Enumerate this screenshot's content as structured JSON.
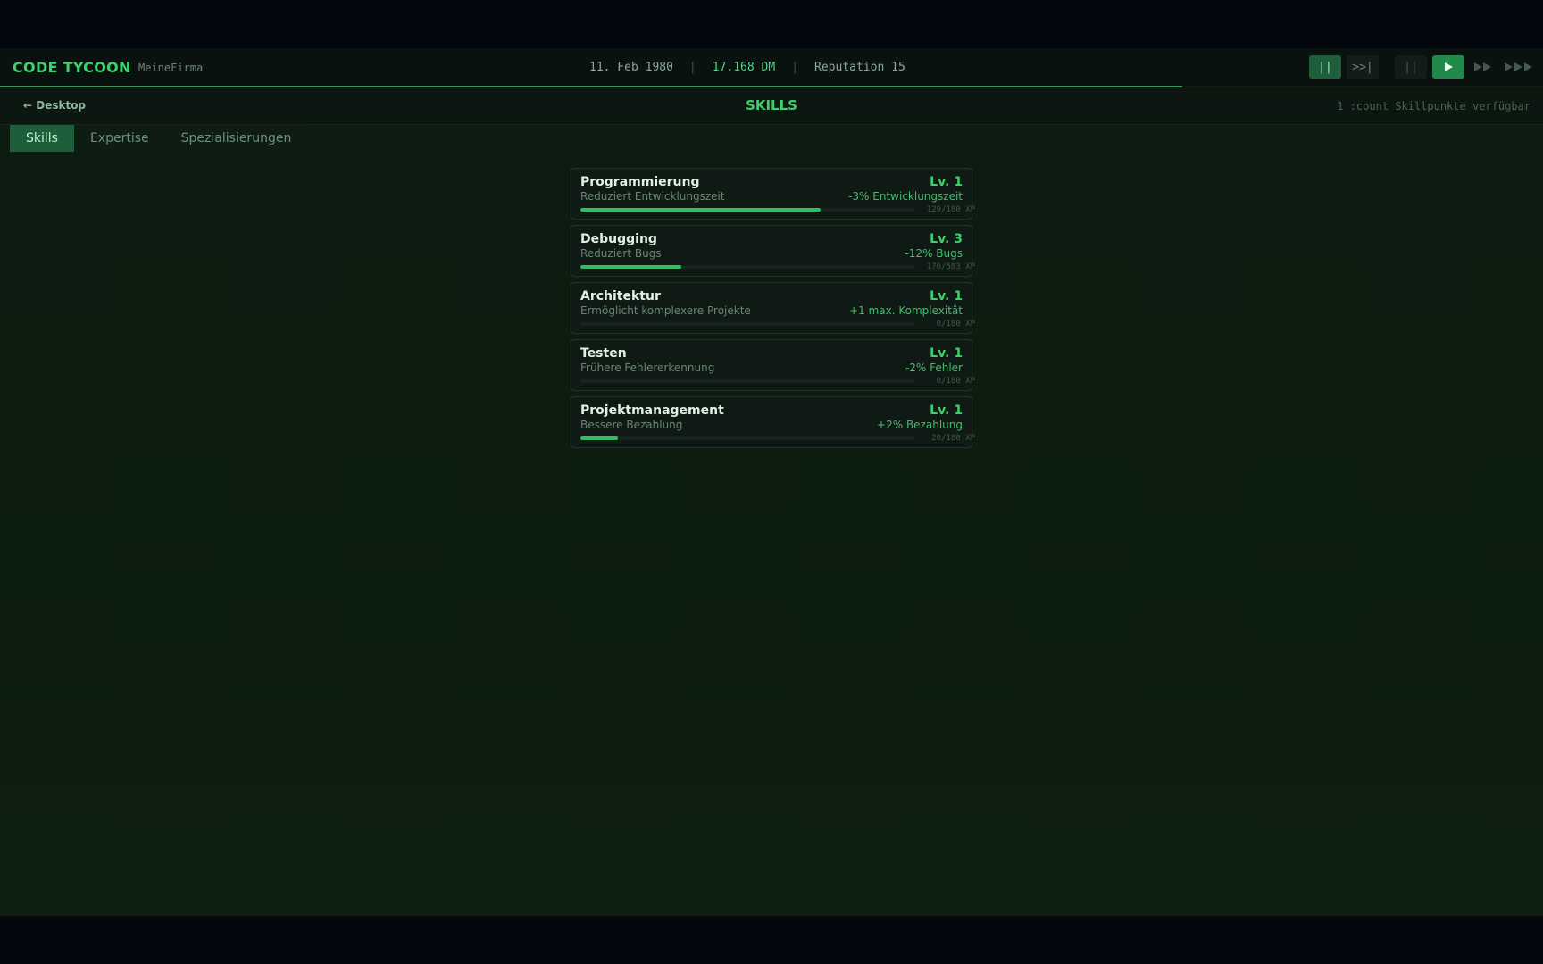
{
  "header": {
    "brand": "CODE TYCOON",
    "company": "MeineFirma",
    "date": "11. Feb 1980",
    "separator": "|",
    "money": "17.168 DM",
    "reputation": "Reputation 15",
    "day_progress": 0.766,
    "controls": {
      "debug_pause": "||",
      "step": ">>|",
      "pause": "||",
      "play": "▶",
      "fast": "▶▶",
      "fastest": "▶▶▶"
    }
  },
  "subheader": {
    "back": "← Desktop",
    "title": "SKILLS",
    "skillpoints": "1 :count Skillpunkte verfügbar"
  },
  "tabs": [
    {
      "label": "Skills",
      "active": true
    },
    {
      "label": "Expertise",
      "active": false
    },
    {
      "label": "Spezialisierungen",
      "active": false
    }
  ],
  "skills": [
    {
      "name": "Programmierung",
      "desc": "Reduziert Entwicklungszeit",
      "level": "Lv. 1",
      "effect": "-3% Entwicklungszeit",
      "xp": "129/180 XP",
      "progress": 0.717
    },
    {
      "name": "Debugging",
      "desc": "Reduziert Bugs",
      "level": "Lv. 3",
      "effect": "-12% Bugs",
      "xp": "176/583 XP",
      "progress": 0.302
    },
    {
      "name": "Architektur",
      "desc": "Ermöglicht komplexere Projekte",
      "level": "Lv. 1",
      "effect": "+1 max. Komplexität",
      "xp": "0/180 XP",
      "progress": 0
    },
    {
      "name": "Testen",
      "desc": "Frühere Fehlererkennung",
      "level": "Lv. 1",
      "effect": "-2% Fehler",
      "xp": "0/180 XP",
      "progress": 0
    },
    {
      "name": "Projektmanagement",
      "desc": "Bessere Bezahlung",
      "level": "Lv. 1",
      "effect": "+2% Bezahlung",
      "xp": "20/180 XP",
      "progress": 0.111
    }
  ]
}
